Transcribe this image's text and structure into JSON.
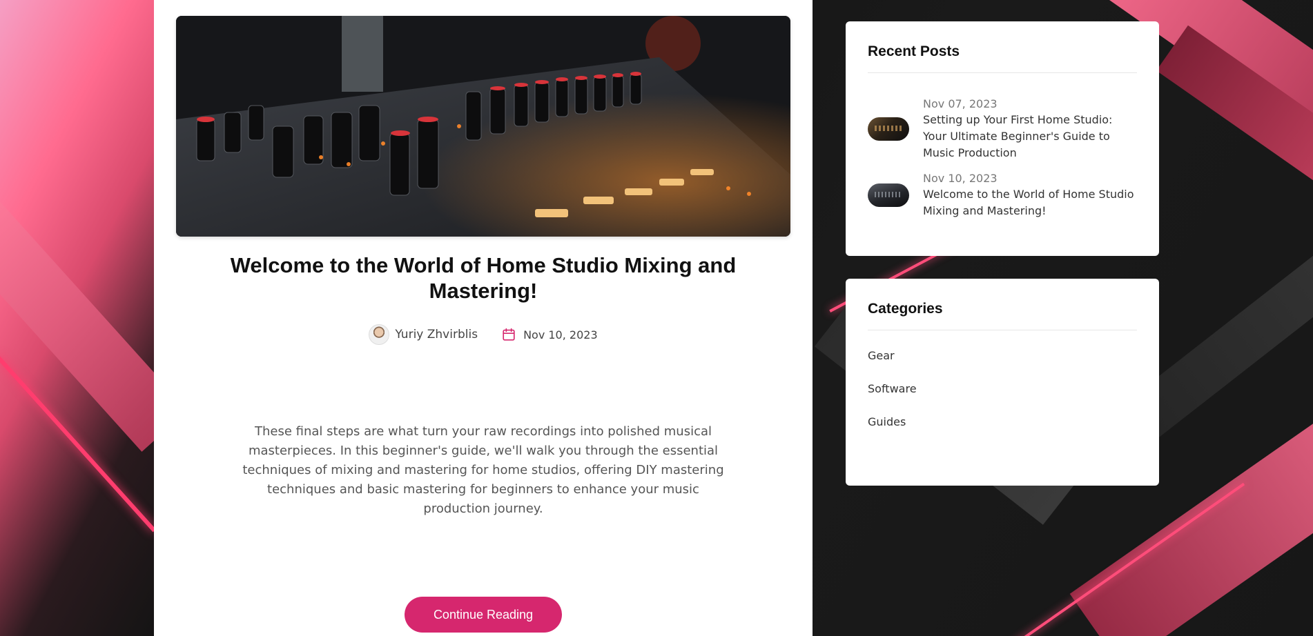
{
  "post": {
    "title": "Welcome to the World of Home Studio Mixing and Mastering!",
    "author": "Yuriy Zhvirblis",
    "date": "Nov 10, 2023",
    "excerpt": "These final steps are what turn your raw recordings into polished musical masterpieces. In this beginner's guide, we'll walk you through the essential techniques of mixing and mastering for home studios, offering DIY mastering techniques and basic mastering for beginners to enhance your music production journey.",
    "cta_label": "Continue Reading"
  },
  "sidebar": {
    "recent": {
      "heading": "Recent Posts",
      "items": [
        {
          "date": "Nov 07, 2023",
          "title": "Setting up Your First Home Studio: Your Ultimate Beginner's Guide to Music Production"
        },
        {
          "date": "Nov 10, 2023",
          "title": "Welcome to the World of Home Studio Mixing and Mastering!"
        }
      ]
    },
    "categories": {
      "heading": "Categories",
      "items": [
        "Gear",
        "Software",
        "Guides"
      ]
    }
  },
  "icons": {
    "calendar": "calendar-icon",
    "avatar": "author-avatar"
  },
  "colors": {
    "accent": "#d6276e",
    "heading": "#111111",
    "body_text": "#555555"
  }
}
